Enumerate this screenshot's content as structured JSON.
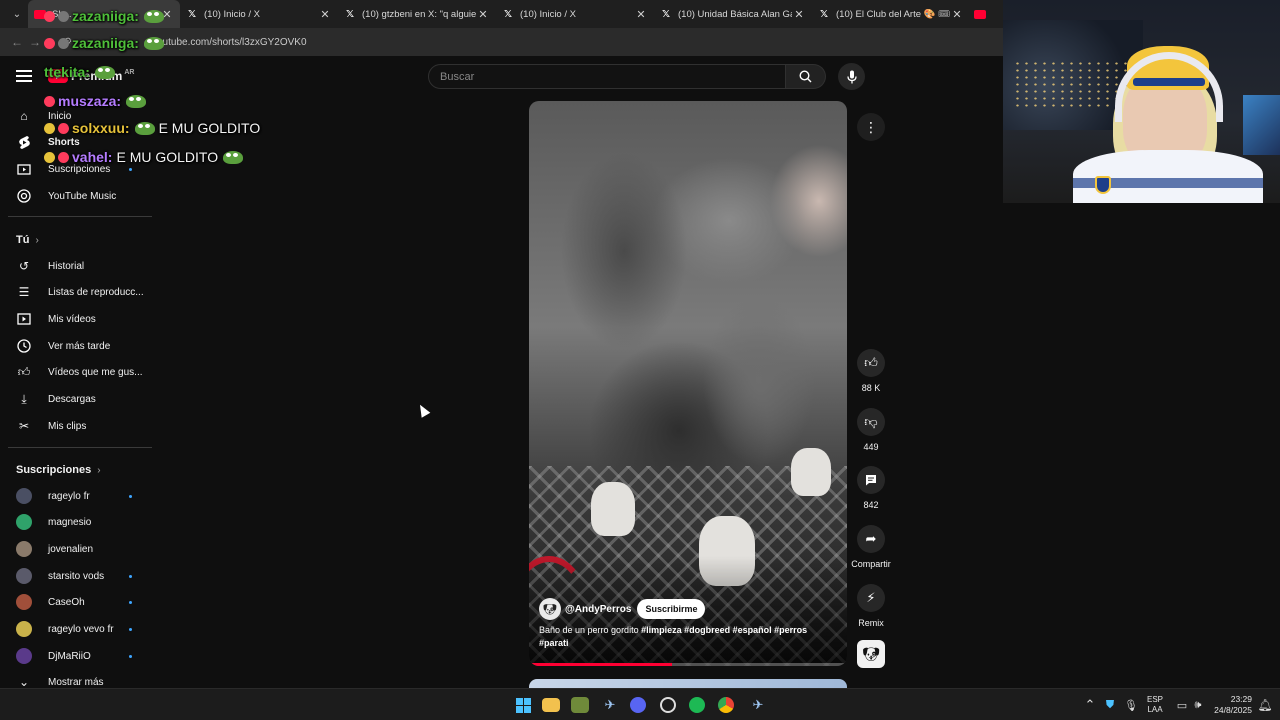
{
  "browser": {
    "tabs": [
      {
        "title": "Sh...",
        "favicon": "youtube-icon",
        "active": true
      },
      {
        "title": "(10) Inicio / X",
        "favicon": "x-icon",
        "active": false
      },
      {
        "title": "(10) gtzbeni en X: \"q alguien m",
        "favicon": "x-icon",
        "active": false
      },
      {
        "title": "(10) Inicio / X",
        "favicon": "x-icon",
        "active": false
      },
      {
        "title": "(10) Unidad Básica Alan Gauto",
        "favicon": "x-icon",
        "active": false
      },
      {
        "title": "(10) El Club del Arte 🎨 🎟 📚",
        "favicon": "x-icon",
        "active": false
      },
      {
        "title": "(1",
        "favicon": "youtube-icon",
        "active": false
      }
    ],
    "url": "youtube.com/shorts/l3zxGY2OVK0"
  },
  "youtube": {
    "logo_text": "Premium",
    "region": "AR",
    "search_placeholder": "Buscar",
    "nav_main": [
      {
        "label": "Inicio",
        "icon": "home-icon"
      },
      {
        "label": "Shorts",
        "icon": "shorts-icon",
        "active": true
      },
      {
        "label": "Suscripciones",
        "icon": "subscriptions-icon",
        "dot": true
      },
      {
        "label": "YouTube Music",
        "icon": "youtube-music-icon"
      }
    ],
    "you_header": "Tú",
    "nav_you": [
      {
        "label": "Historial",
        "icon": "history-icon"
      },
      {
        "label": "Listas de reproducc...",
        "icon": "playlists-icon"
      },
      {
        "label": "Mis vídeos",
        "icon": "my-videos-icon"
      },
      {
        "label": "Ver más tarde",
        "icon": "watch-later-icon"
      },
      {
        "label": "Vídeos que me gus...",
        "icon": "liked-videos-icon"
      },
      {
        "label": "Descargas",
        "icon": "downloads-icon"
      },
      {
        "label": "Mis clips",
        "icon": "clips-icon"
      }
    ],
    "subs_header": "Suscripciones",
    "subscriptions": [
      {
        "label": "rageylo fr",
        "dot": true,
        "color": "#4a4f63"
      },
      {
        "label": "magnesio",
        "dot": false,
        "color": "#2fa26a"
      },
      {
        "label": "jovenalien",
        "dot": false,
        "color": "#8a7a6a"
      },
      {
        "label": "starsito vods",
        "dot": true,
        "color": "#5a5a6a"
      },
      {
        "label": "CaseOh",
        "dot": true,
        "color": "#a04f3a"
      },
      {
        "label": "rageylo vevo fr",
        "dot": true,
        "color": "#c9b24a"
      },
      {
        "label": "DjMaRiiO",
        "dot": true,
        "color": "#5a3a8a"
      }
    ],
    "show_more": "Mostrar más",
    "short": {
      "channel": "@AndyPerros",
      "subscribe_label": "Suscribirme",
      "caption_text": "Baño de un perro gordito ",
      "caption_tags": "#limpieza #dogbreed #español #perros #parati",
      "progress": 0.45,
      "likes": "88 K",
      "dislikes": "449",
      "comments": "842",
      "share_label": "Compartir",
      "remix_label": "Remix"
    }
  },
  "chat_overlay": [
    {
      "user": "zazaniiga:",
      "color": "#4fbf3a",
      "message": "",
      "emote": "pepe-emote"
    },
    {
      "user": "ttekita:",
      "color": "#4fbf3a",
      "message": "",
      "emote": "pepe-emote"
    },
    {
      "user": "muszaza:",
      "color": "#b57cff",
      "message": "",
      "emote": "pepe-emote"
    },
    {
      "user": "solxxuu:",
      "color": "#e6c23a",
      "message": "E MU GOLDITO",
      "emote": "pepe-emote"
    },
    {
      "user": "vahel:",
      "color": "#b57cff",
      "message": "E MU GOLDITO",
      "emote": "pepe-emote"
    }
  ],
  "taskbar": {
    "apps": [
      "windows-start-icon",
      "file-explorer-icon",
      "spreadsheet-icon",
      "steam-icon",
      "discord-icon",
      "obs-icon",
      "spotify-icon",
      "chrome-icon",
      "steam-alt-icon"
    ],
    "lang_line1": "ESP",
    "lang_line2": "LAA",
    "time": "23:29",
    "date": "24/8/2025"
  }
}
